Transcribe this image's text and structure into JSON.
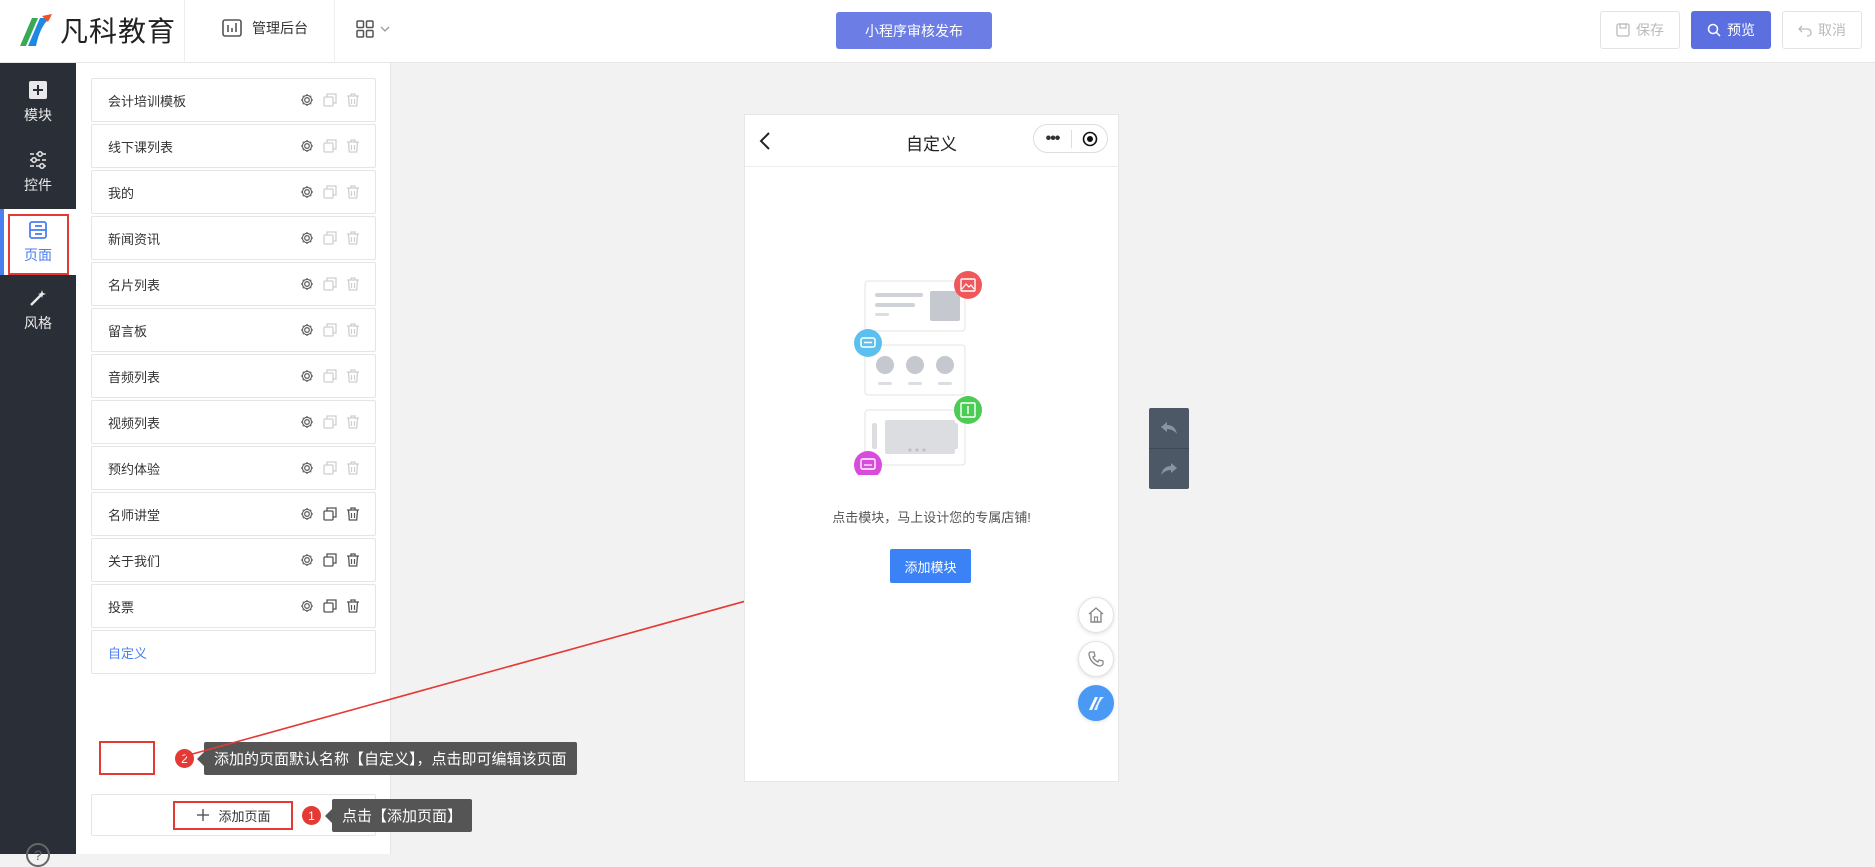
{
  "header": {
    "logo_text": "凡科教育",
    "admin_label": "管理后台",
    "publish_label": "小程序审核发布",
    "save_label": "保存",
    "preview_label": "预览",
    "cancel_label": "取消"
  },
  "sidebar": {
    "items": [
      {
        "label": "模块",
        "icon": "plus-square-icon"
      },
      {
        "label": "控件",
        "icon": "sliders-icon"
      },
      {
        "label": "页面",
        "icon": "pages-icon"
      },
      {
        "label": "风格",
        "icon": "magic-wand-icon"
      }
    ],
    "help": "?"
  },
  "pages": [
    {
      "name": "会计培训模板"
    },
    {
      "name": "线下课列表"
    },
    {
      "name": "我的"
    },
    {
      "name": "新闻资讯"
    },
    {
      "name": "名片列表"
    },
    {
      "name": "留言板"
    },
    {
      "name": "音频列表"
    },
    {
      "name": "视频列表"
    },
    {
      "name": "预约体验"
    },
    {
      "name": "名师讲堂"
    },
    {
      "name": "关于我们"
    },
    {
      "name": "投票"
    },
    {
      "name": "自定义"
    }
  ],
  "add_page_label": "添加页面",
  "annotations": {
    "step1_num": "1",
    "step1_text": "点击【添加页面】",
    "step2_num": "2",
    "step2_text": "添加的页面默认名称【自定义】，点击即可编辑该页面"
  },
  "phone": {
    "title": "自定义",
    "capsule_dots": "•••",
    "empty_text": "点击模块，马上设计您的专属店铺!",
    "add_module_label": "添加模块"
  },
  "colors": {
    "primary": "#5b6fe0",
    "accent_blue": "#3b82f6",
    "sidebar_bg": "#2a2e36",
    "annotation_red": "#e53935"
  }
}
